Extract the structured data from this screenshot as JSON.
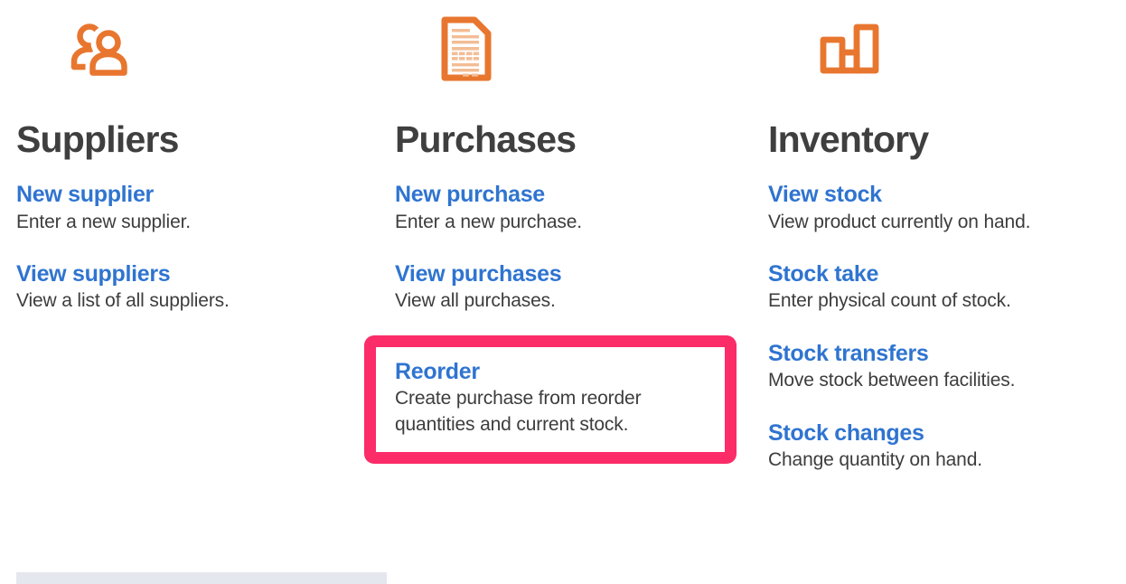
{
  "theme": {
    "accent_blue": "#2f74d0",
    "icon_orange": "#e8762f",
    "heading_gray": "#3f3f3f",
    "body_gray": "#3d3d3d",
    "highlight_pink": "#fb2c68",
    "bar_gray": "#e4e7ee",
    "page_background": "#ffffff"
  },
  "columns": [
    {
      "id": "suppliers",
      "title": "Suppliers",
      "icon": "people-icon",
      "links": [
        {
          "title": "New supplier",
          "description": "Enter a new supplier.",
          "highlighted": false
        },
        {
          "title": "View suppliers",
          "description": "View a list of all suppliers.",
          "highlighted": false
        }
      ]
    },
    {
      "id": "purchases",
      "title": "Purchases",
      "icon": "invoice-document-icon",
      "links": [
        {
          "title": "New purchase",
          "description": "Enter a new purchase.",
          "highlighted": false
        },
        {
          "title": "View purchases",
          "description": "View all purchases.",
          "highlighted": false
        },
        {
          "title": "Reorder",
          "description": "Create purchase from reorder quantities and current stock.",
          "highlighted": true
        }
      ]
    },
    {
      "id": "inventory",
      "title": "Inventory",
      "icon": "bar-chart-icon",
      "links": [
        {
          "title": "View stock",
          "description": "View product currently on hand.",
          "highlighted": false
        },
        {
          "title": "Stock take",
          "description": "Enter physical count of stock.",
          "highlighted": false
        },
        {
          "title": "Stock transfers",
          "description": "Move stock between facilities.",
          "highlighted": false
        },
        {
          "title": "Stock changes",
          "description": "Change quantity on hand.",
          "highlighted": false
        }
      ]
    }
  ]
}
